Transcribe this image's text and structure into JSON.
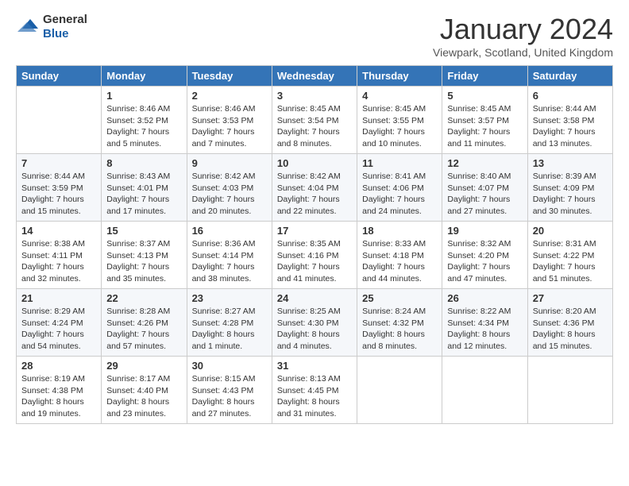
{
  "header": {
    "logo_general": "General",
    "logo_blue": "Blue",
    "month_title": "January 2024",
    "location": "Viewpark, Scotland, United Kingdom"
  },
  "columns": [
    "Sunday",
    "Monday",
    "Tuesday",
    "Wednesday",
    "Thursday",
    "Friday",
    "Saturday"
  ],
  "weeks": [
    [
      {
        "day": "",
        "sunrise": "",
        "sunset": "",
        "daylight": ""
      },
      {
        "day": "1",
        "sunrise": "Sunrise: 8:46 AM",
        "sunset": "Sunset: 3:52 PM",
        "daylight": "Daylight: 7 hours and 5 minutes."
      },
      {
        "day": "2",
        "sunrise": "Sunrise: 8:46 AM",
        "sunset": "Sunset: 3:53 PM",
        "daylight": "Daylight: 7 hours and 7 minutes."
      },
      {
        "day": "3",
        "sunrise": "Sunrise: 8:45 AM",
        "sunset": "Sunset: 3:54 PM",
        "daylight": "Daylight: 7 hours and 8 minutes."
      },
      {
        "day": "4",
        "sunrise": "Sunrise: 8:45 AM",
        "sunset": "Sunset: 3:55 PM",
        "daylight": "Daylight: 7 hours and 10 minutes."
      },
      {
        "day": "5",
        "sunrise": "Sunrise: 8:45 AM",
        "sunset": "Sunset: 3:57 PM",
        "daylight": "Daylight: 7 hours and 11 minutes."
      },
      {
        "day": "6",
        "sunrise": "Sunrise: 8:44 AM",
        "sunset": "Sunset: 3:58 PM",
        "daylight": "Daylight: 7 hours and 13 minutes."
      }
    ],
    [
      {
        "day": "7",
        "sunrise": "Sunrise: 8:44 AM",
        "sunset": "Sunset: 3:59 PM",
        "daylight": "Daylight: 7 hours and 15 minutes."
      },
      {
        "day": "8",
        "sunrise": "Sunrise: 8:43 AM",
        "sunset": "Sunset: 4:01 PM",
        "daylight": "Daylight: 7 hours and 17 minutes."
      },
      {
        "day": "9",
        "sunrise": "Sunrise: 8:42 AM",
        "sunset": "Sunset: 4:03 PM",
        "daylight": "Daylight: 7 hours and 20 minutes."
      },
      {
        "day": "10",
        "sunrise": "Sunrise: 8:42 AM",
        "sunset": "Sunset: 4:04 PM",
        "daylight": "Daylight: 7 hours and 22 minutes."
      },
      {
        "day": "11",
        "sunrise": "Sunrise: 8:41 AM",
        "sunset": "Sunset: 4:06 PM",
        "daylight": "Daylight: 7 hours and 24 minutes."
      },
      {
        "day": "12",
        "sunrise": "Sunrise: 8:40 AM",
        "sunset": "Sunset: 4:07 PM",
        "daylight": "Daylight: 7 hours and 27 minutes."
      },
      {
        "day": "13",
        "sunrise": "Sunrise: 8:39 AM",
        "sunset": "Sunset: 4:09 PM",
        "daylight": "Daylight: 7 hours and 30 minutes."
      }
    ],
    [
      {
        "day": "14",
        "sunrise": "Sunrise: 8:38 AM",
        "sunset": "Sunset: 4:11 PM",
        "daylight": "Daylight: 7 hours and 32 minutes."
      },
      {
        "day": "15",
        "sunrise": "Sunrise: 8:37 AM",
        "sunset": "Sunset: 4:13 PM",
        "daylight": "Daylight: 7 hours and 35 minutes."
      },
      {
        "day": "16",
        "sunrise": "Sunrise: 8:36 AM",
        "sunset": "Sunset: 4:14 PM",
        "daylight": "Daylight: 7 hours and 38 minutes."
      },
      {
        "day": "17",
        "sunrise": "Sunrise: 8:35 AM",
        "sunset": "Sunset: 4:16 PM",
        "daylight": "Daylight: 7 hours and 41 minutes."
      },
      {
        "day": "18",
        "sunrise": "Sunrise: 8:33 AM",
        "sunset": "Sunset: 4:18 PM",
        "daylight": "Daylight: 7 hours and 44 minutes."
      },
      {
        "day": "19",
        "sunrise": "Sunrise: 8:32 AM",
        "sunset": "Sunset: 4:20 PM",
        "daylight": "Daylight: 7 hours and 47 minutes."
      },
      {
        "day": "20",
        "sunrise": "Sunrise: 8:31 AM",
        "sunset": "Sunset: 4:22 PM",
        "daylight": "Daylight: 7 hours and 51 minutes."
      }
    ],
    [
      {
        "day": "21",
        "sunrise": "Sunrise: 8:29 AM",
        "sunset": "Sunset: 4:24 PM",
        "daylight": "Daylight: 7 hours and 54 minutes."
      },
      {
        "day": "22",
        "sunrise": "Sunrise: 8:28 AM",
        "sunset": "Sunset: 4:26 PM",
        "daylight": "Daylight: 7 hours and 57 minutes."
      },
      {
        "day": "23",
        "sunrise": "Sunrise: 8:27 AM",
        "sunset": "Sunset: 4:28 PM",
        "daylight": "Daylight: 8 hours and 1 minute."
      },
      {
        "day": "24",
        "sunrise": "Sunrise: 8:25 AM",
        "sunset": "Sunset: 4:30 PM",
        "daylight": "Daylight: 8 hours and 4 minutes."
      },
      {
        "day": "25",
        "sunrise": "Sunrise: 8:24 AM",
        "sunset": "Sunset: 4:32 PM",
        "daylight": "Daylight: 8 hours and 8 minutes."
      },
      {
        "day": "26",
        "sunrise": "Sunrise: 8:22 AM",
        "sunset": "Sunset: 4:34 PM",
        "daylight": "Daylight: 8 hours and 12 minutes."
      },
      {
        "day": "27",
        "sunrise": "Sunrise: 8:20 AM",
        "sunset": "Sunset: 4:36 PM",
        "daylight": "Daylight: 8 hours and 15 minutes."
      }
    ],
    [
      {
        "day": "28",
        "sunrise": "Sunrise: 8:19 AM",
        "sunset": "Sunset: 4:38 PM",
        "daylight": "Daylight: 8 hours and 19 minutes."
      },
      {
        "day": "29",
        "sunrise": "Sunrise: 8:17 AM",
        "sunset": "Sunset: 4:40 PM",
        "daylight": "Daylight: 8 hours and 23 minutes."
      },
      {
        "day": "30",
        "sunrise": "Sunrise: 8:15 AM",
        "sunset": "Sunset: 4:43 PM",
        "daylight": "Daylight: 8 hours and 27 minutes."
      },
      {
        "day": "31",
        "sunrise": "Sunrise: 8:13 AM",
        "sunset": "Sunset: 4:45 PM",
        "daylight": "Daylight: 8 hours and 31 minutes."
      },
      {
        "day": "",
        "sunrise": "",
        "sunset": "",
        "daylight": ""
      },
      {
        "day": "",
        "sunrise": "",
        "sunset": "",
        "daylight": ""
      },
      {
        "day": "",
        "sunrise": "",
        "sunset": "",
        "daylight": ""
      }
    ]
  ]
}
